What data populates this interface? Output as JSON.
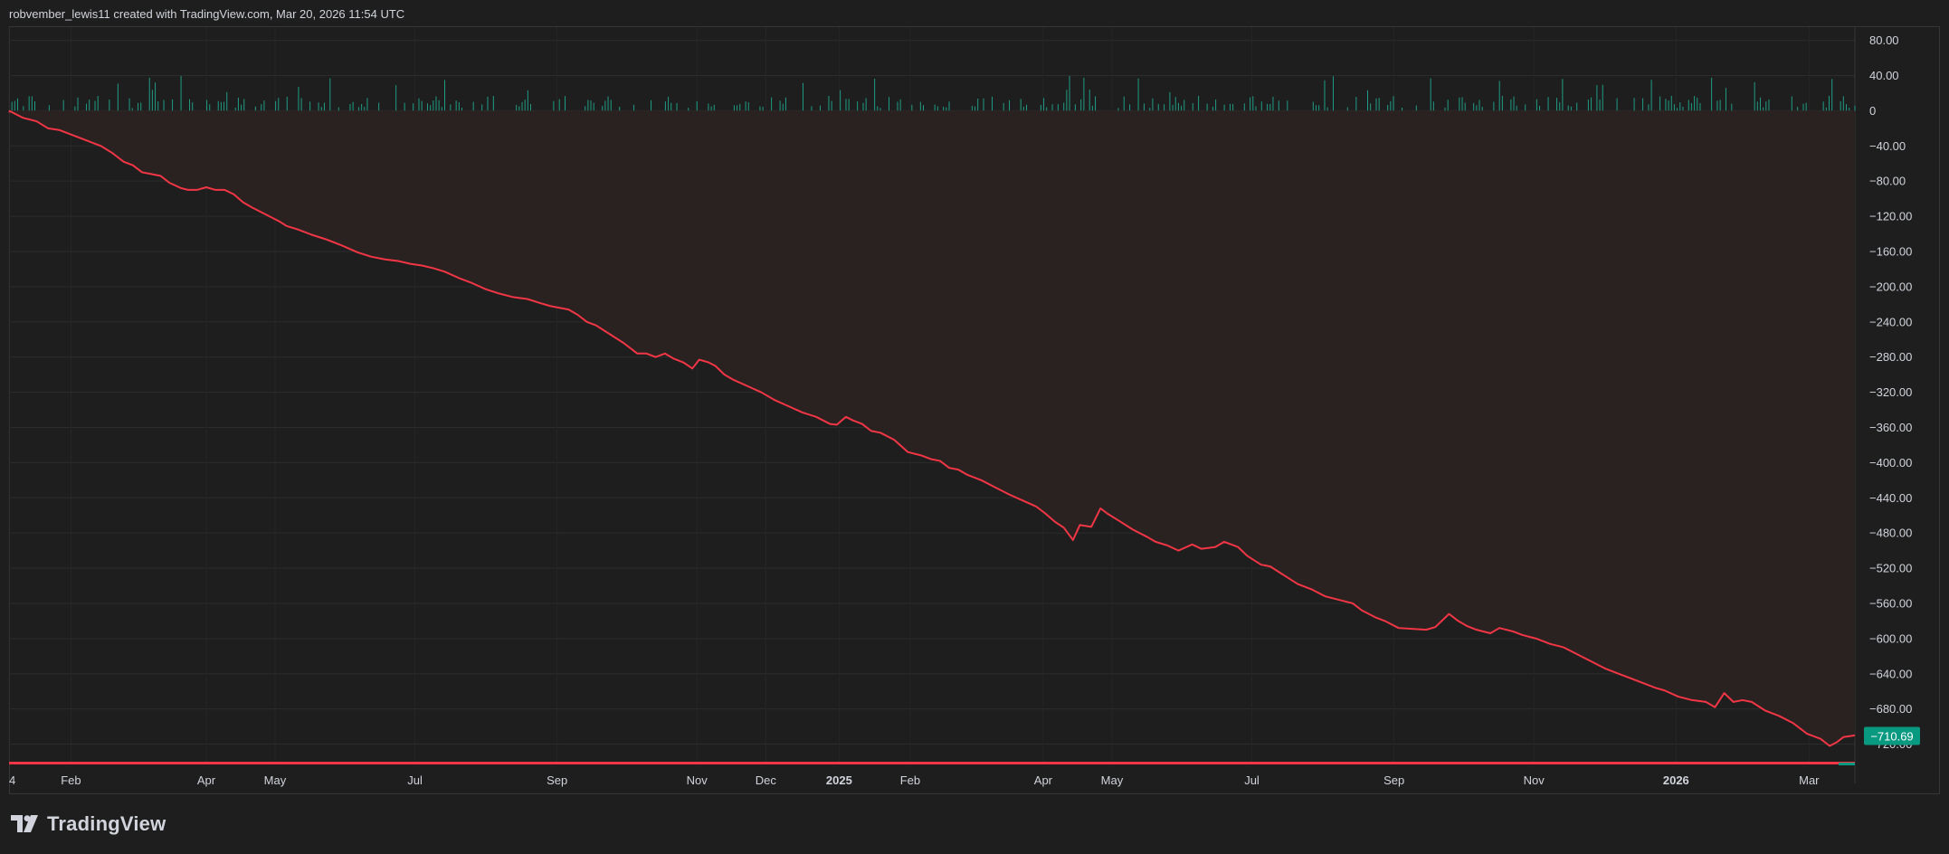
{
  "header": {
    "credit": "robvember_lewis11 created with TradingView.com, Mar 20, 2026 11:54 UTC"
  },
  "brand": {
    "name": "TradingView",
    "icon": "tradingview-logo-icon"
  },
  "colors": {
    "background": "#1e1e1e",
    "grid": "#2c2c2c",
    "line": "#f23645",
    "fill": "#2a2121",
    "bar_up": "#1f9c84",
    "bar_down": "#b0283a",
    "badge": "#089981",
    "axis_text": "#d1d4dc"
  },
  "chart_data": {
    "type": "line",
    "y_axis": {
      "ylim": [
        -740,
        95
      ],
      "ticks": [
        80,
        40,
        0,
        -40,
        -80,
        -120,
        -160,
        -200,
        -240,
        -280,
        -320,
        -360,
        -400,
        -440,
        -480,
        -520,
        -560,
        -600,
        -640,
        -680,
        -720
      ],
      "tick_labels": [
        "80.00",
        "40.00",
        "0",
        "−40.00",
        "−80.00",
        "−120.00",
        "−160.00",
        "−200.00",
        "−240.00",
        "−280.00",
        "−320.00",
        "−360.00",
        "−400.00",
        "−440.00",
        "−480.00",
        "−520.00",
        "−560.00",
        "−600.00",
        "−640.00",
        "−680.00",
        "−720.00"
      ],
      "position": "right"
    },
    "x_axis": {
      "labels": [
        {
          "t": 0,
          "text": "4",
          "bold": false
        },
        {
          "t": 27,
          "text": "Feb",
          "bold": false
        },
        {
          "t": 86,
          "text": "Apr",
          "bold": false
        },
        {
          "t": 116,
          "text": "May",
          "bold": false
        },
        {
          "t": 177,
          "text": "Jul",
          "bold": false
        },
        {
          "t": 239,
          "text": "Sep",
          "bold": false
        },
        {
          "t": 300,
          "text": "Nov",
          "bold": false
        },
        {
          "t": 330,
          "text": "Dec",
          "bold": false
        },
        {
          "t": 362,
          "text": "2025",
          "bold": true
        },
        {
          "t": 393,
          "text": "Feb",
          "bold": false
        },
        {
          "t": 451,
          "text": "Apr",
          "bold": false
        },
        {
          "t": 481,
          "text": "May",
          "bold": false
        },
        {
          "t": 542,
          "text": "Jul",
          "bold": false
        },
        {
          "t": 604,
          "text": "Sep",
          "bold": false
        },
        {
          "t": 665,
          "text": "Nov",
          "bold": false
        },
        {
          "t": 727,
          "text": "2026",
          "bold": true
        },
        {
          "t": 785,
          "text": "Mar",
          "bold": false
        }
      ],
      "tmax": 805
    },
    "series": [
      {
        "style": "line",
        "baseline": 0,
        "points": [
          [
            0,
            0
          ],
          [
            6,
            -8
          ],
          [
            12,
            -12
          ],
          [
            17,
            -20
          ],
          [
            22,
            -22
          ],
          [
            30,
            -30
          ],
          [
            40,
            -40
          ],
          [
            45,
            -48
          ],
          [
            50,
            -58
          ],
          [
            54,
            -62
          ],
          [
            58,
            -70
          ],
          [
            62,
            -72
          ],
          [
            66,
            -74
          ],
          [
            70,
            -82
          ],
          [
            75,
            -88
          ],
          [
            78,
            -90
          ],
          [
            82,
            -90
          ],
          [
            86,
            -87
          ],
          [
            90,
            -90
          ],
          [
            94,
            -90
          ],
          [
            98,
            -95
          ],
          [
            102,
            -104
          ],
          [
            106,
            -110
          ],
          [
            112,
            -118
          ],
          [
            118,
            -126
          ],
          [
            121,
            -131
          ],
          [
            126,
            -135
          ],
          [
            132,
            -141
          ],
          [
            138,
            -146
          ],
          [
            145,
            -153
          ],
          [
            152,
            -161
          ],
          [
            158,
            -166
          ],
          [
            164,
            -169
          ],
          [
            170,
            -171
          ],
          [
            175,
            -174
          ],
          [
            180,
            -176
          ],
          [
            185,
            -179
          ],
          [
            190,
            -183
          ],
          [
            196,
            -190
          ],
          [
            202,
            -196
          ],
          [
            208,
            -203
          ],
          [
            214,
            -208
          ],
          [
            220,
            -212
          ],
          [
            226,
            -214
          ],
          [
            232,
            -219
          ],
          [
            236,
            -222
          ],
          [
            240,
            -224
          ],
          [
            244,
            -226
          ],
          [
            248,
            -232
          ],
          [
            252,
            -240
          ],
          [
            256,
            -244
          ],
          [
            262,
            -254
          ],
          [
            268,
            -264
          ],
          [
            274,
            -276
          ],
          [
            278,
            -276
          ],
          [
            282,
            -280
          ],
          [
            286,
            -276
          ],
          [
            290,
            -282
          ],
          [
            294,
            -286
          ],
          [
            298,
            -293
          ],
          [
            301,
            -283
          ],
          [
            305,
            -286
          ],
          [
            308,
            -290
          ],
          [
            312,
            -300
          ],
          [
            316,
            -306
          ],
          [
            322,
            -313
          ],
          [
            328,
            -320
          ],
          [
            334,
            -329
          ],
          [
            340,
            -336
          ],
          [
            346,
            -343
          ],
          [
            352,
            -348
          ],
          [
            358,
            -356
          ],
          [
            361,
            -357
          ],
          [
            365,
            -348
          ],
          [
            368,
            -352
          ],
          [
            372,
            -356
          ],
          [
            376,
            -364
          ],
          [
            380,
            -366
          ],
          [
            386,
            -374
          ],
          [
            392,
            -388
          ],
          [
            398,
            -392
          ],
          [
            402,
            -396
          ],
          [
            406,
            -398
          ],
          [
            410,
            -406
          ],
          [
            414,
            -408
          ],
          [
            418,
            -414
          ],
          [
            424,
            -420
          ],
          [
            430,
            -428
          ],
          [
            436,
            -436
          ],
          [
            442,
            -443
          ],
          [
            448,
            -450
          ],
          [
            452,
            -458
          ],
          [
            456,
            -467
          ],
          [
            460,
            -474
          ],
          [
            464,
            -488
          ],
          [
            467,
            -471
          ],
          [
            472,
            -473
          ],
          [
            476,
            -452
          ],
          [
            479,
            -458
          ],
          [
            484,
            -466
          ],
          [
            490,
            -476
          ],
          [
            496,
            -484
          ],
          [
            500,
            -490
          ],
          [
            505,
            -494
          ],
          [
            510,
            -500
          ],
          [
            516,
            -493
          ],
          [
            520,
            -498
          ],
          [
            526,
            -496
          ],
          [
            530,
            -490
          ],
          [
            536,
            -496
          ],
          [
            540,
            -506
          ],
          [
            546,
            -516
          ],
          [
            550,
            -518
          ],
          [
            556,
            -528
          ],
          [
            562,
            -538
          ],
          [
            568,
            -544
          ],
          [
            574,
            -552
          ],
          [
            580,
            -556
          ],
          [
            586,
            -560
          ],
          [
            590,
            -568
          ],
          [
            596,
            -576
          ],
          [
            600,
            -580
          ],
          [
            606,
            -588
          ],
          [
            612,
            -589
          ],
          [
            618,
            -590
          ],
          [
            622,
            -587
          ],
          [
            628,
            -572
          ],
          [
            632,
            -580
          ],
          [
            636,
            -586
          ],
          [
            640,
            -590
          ],
          [
            646,
            -594
          ],
          [
            650,
            -588
          ],
          [
            656,
            -592
          ],
          [
            660,
            -596
          ],
          [
            666,
            -600
          ],
          [
            672,
            -606
          ],
          [
            678,
            -610
          ],
          [
            684,
            -618
          ],
          [
            690,
            -626
          ],
          [
            696,
            -634
          ],
          [
            702,
            -640
          ],
          [
            708,
            -646
          ],
          [
            712,
            -650
          ],
          [
            718,
            -656
          ],
          [
            722,
            -659
          ],
          [
            728,
            -666
          ],
          [
            734,
            -670
          ],
          [
            740,
            -672
          ],
          [
            744,
            -678
          ],
          [
            748,
            -662
          ],
          [
            752,
            -672
          ],
          [
            756,
            -670
          ],
          [
            760,
            -672
          ],
          [
            766,
            -682
          ],
          [
            772,
            -688
          ],
          [
            778,
            -696
          ],
          [
            784,
            -708
          ],
          [
            790,
            -714
          ],
          [
            794,
            -722
          ],
          [
            797,
            -718
          ],
          [
            800,
            -712
          ],
          [
            805,
            -710
          ]
        ]
      }
    ],
    "last_value": {
      "value": -710.69,
      "label": "−710.69"
    },
    "grid": true,
    "legend": "none"
  }
}
